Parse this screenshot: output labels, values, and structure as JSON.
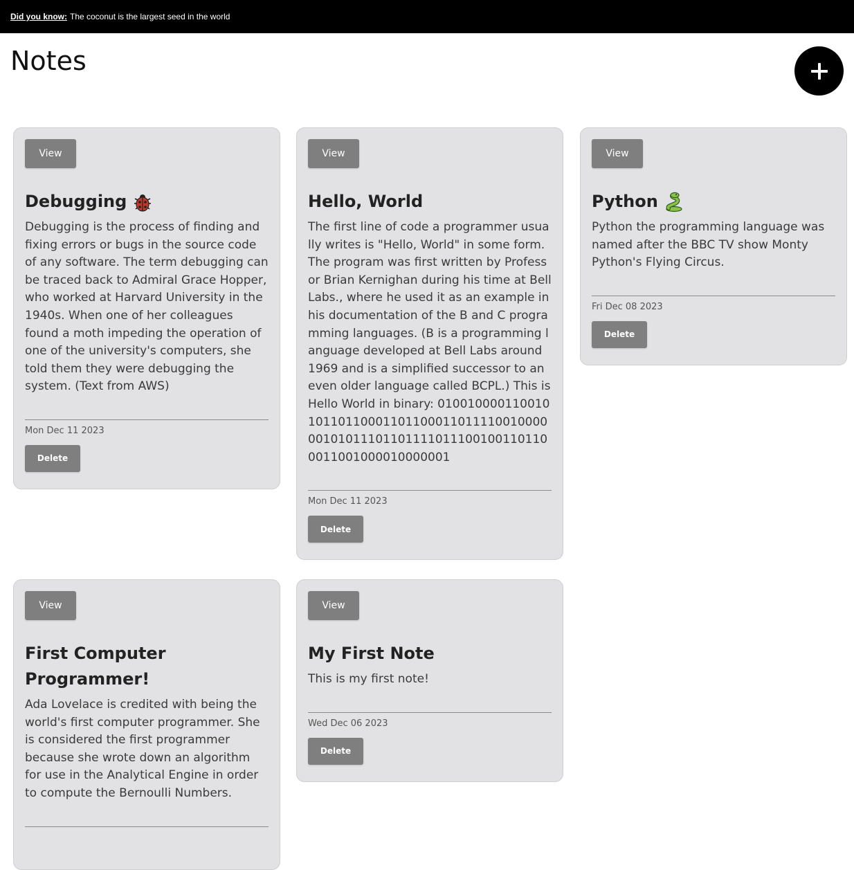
{
  "banner": {
    "label": "Did you know:",
    "fact": "The coconut is the largest seed in the world"
  },
  "page": {
    "title": "Notes",
    "add_icon": "plus-icon"
  },
  "notes": [
    {
      "view_label": "View",
      "title": "Debugging",
      "emoji_icon": "ladybug-icon",
      "body": "Debugging is the process of finding and fixing errors or bugs in the source code of any software. The term debugging can be traced back to Admiral Grace Hopper, who worked at Harvard University in the 1940s. When one of her colleagues found a moth impeding the operation of one of the university's computers, she told them they were debugging the system. (Text from AWS)",
      "date": "Mon Dec 11 2023",
      "delete_label": "Delete"
    },
    {
      "view_label": "View",
      "title": "Hello, World",
      "body": "The first line of code a programmer usually writes is \"Hello, World\" in some form. The program was first written by Professor Brian Kernighan during his time at Bell Labs., where he used it as an example in his documentation of the B and C programming languages. (B is a programming language developed at Bell Labs around 1969 and is a simplified successor to an even older language called BCPL.) This is Hello World in binary: 01001000011001010110110001101100011011110010000001010111011011110111001001101100011001000010000001",
      "date": "Mon Dec 11 2023",
      "delete_label": "Delete"
    },
    {
      "view_label": "View",
      "title": "Python",
      "emoji_icon": "snake-icon",
      "body": "Python the programming language was named after the BBC TV show Monty Python's Flying Circus.",
      "date": "Fri Dec 08 2023",
      "delete_label": "Delete"
    },
    {
      "view_label": "View",
      "title": "First Computer Programmer!",
      "body": "Ada Lovelace is credited with being the world's first computer programmer. She is considered the first programmer because she wrote down an algorithm for use in the Analytical Engine in order to compute the Bernoulli Numbers."
    },
    {
      "view_label": "View",
      "title": "My First Note",
      "body": "This is my first note!",
      "date": "Wed Dec 06 2023",
      "delete_label": "Delete"
    }
  ],
  "colors": {
    "banner_bg": "#000000",
    "card_bg": "#e2e2e4",
    "button_bg": "#7f7f7f",
    "add_button_bg": "#000000"
  }
}
